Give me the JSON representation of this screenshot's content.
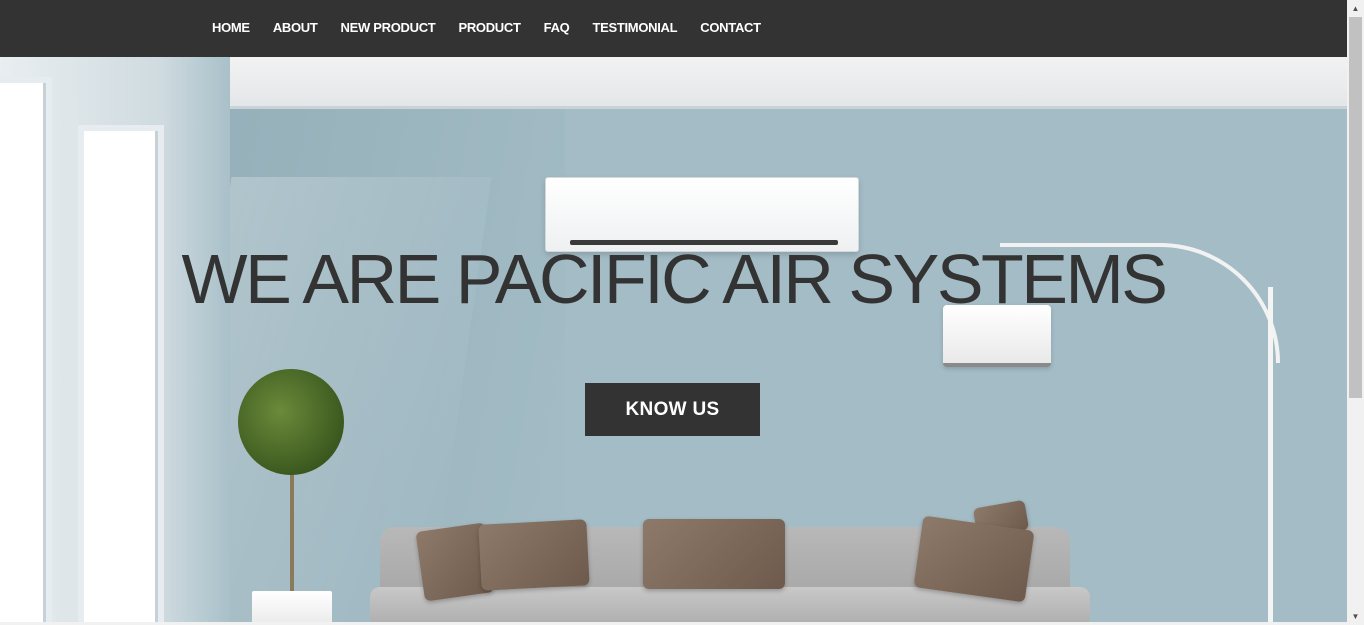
{
  "nav": {
    "items": [
      {
        "label": "HOME"
      },
      {
        "label": "ABOUT"
      },
      {
        "label": "NEW PRODUCT"
      },
      {
        "label": "PRODUCT"
      },
      {
        "label": "FAQ"
      },
      {
        "label": "TESTIMONIAL"
      },
      {
        "label": "CONTACT"
      }
    ]
  },
  "hero": {
    "title": "WE ARE PACIFIC AIR SYSTEMS",
    "button_label": "KNOW US",
    "image_icons": [
      "air-conditioner-icon",
      "floor-lamp-icon",
      "potted-plant-icon",
      "sofa-icon"
    ]
  },
  "scrollbar": {
    "up_glyph": "▲",
    "down_glyph": "▼"
  },
  "colors": {
    "navbar_bg": "#333333",
    "nav_text": "#ffffff",
    "title_text": "#333333",
    "button_bg": "#333333",
    "button_text": "#ffffff",
    "wall": "#a3bcc6"
  }
}
